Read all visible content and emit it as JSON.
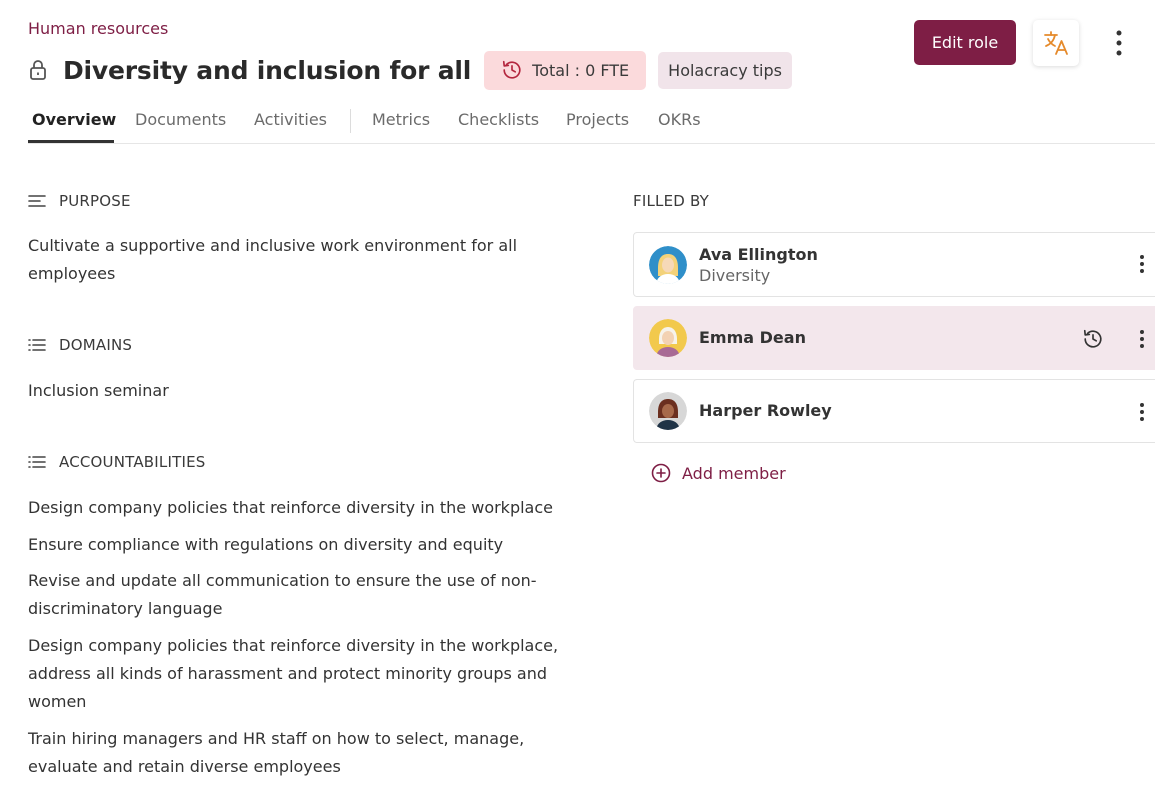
{
  "breadcrumb": "Human resources",
  "header": {
    "title": "Diversity and inclusion for all",
    "fte_badge": "Total : 0 FTE",
    "tips_badge": "Holacracy tips",
    "edit_button": "Edit role"
  },
  "tabs": [
    {
      "label": "Overview",
      "active": true
    },
    {
      "label": "Documents"
    },
    {
      "label": "Activities"
    },
    {
      "label": "Metrics"
    },
    {
      "label": "Checklists"
    },
    {
      "label": "Projects"
    },
    {
      "label": "OKRs"
    }
  ],
  "purpose": {
    "heading": "PURPOSE",
    "text": "Cultivate a supportive and inclusive work environment for all employees"
  },
  "domains": {
    "heading": "DOMAINS",
    "items": [
      "Inclusion seminar"
    ]
  },
  "accountabilities": {
    "heading": "ACCOUNTABILITIES",
    "items": [
      "Design company policies that reinforce diversity in the workplace",
      "Ensure compliance with regulations on diversity and equity",
      "Revise and update all communication to ensure the use of non-discriminatory language",
      "Design company policies that reinforce diversity in the workplace, address all kinds of harassment and protect minority groups and women",
      "Train hiring managers and HR staff on how to select, manage, evaluate and retain diverse employees"
    ]
  },
  "filled_by": {
    "heading": "FILLED BY",
    "members": [
      {
        "name": "Ava Ellington",
        "subtitle": "Diversity"
      },
      {
        "name": "Emma Dean",
        "subtitle": ""
      },
      {
        "name": "Harper Rowley",
        "subtitle": ""
      }
    ],
    "add_label": "Add member"
  },
  "colors": {
    "brand": "#7e1e45",
    "fte_badge_bg": "#fbdadc",
    "tips_badge_bg": "#f1e4ea",
    "highlight_row": "#f3e7ec",
    "translate_icon": "#e58a2b"
  },
  "icons": [
    "lock-icon",
    "history-icon",
    "translate-icon",
    "more-vertical-icon",
    "text-align-icon",
    "list-icon",
    "add-circle-icon"
  ]
}
